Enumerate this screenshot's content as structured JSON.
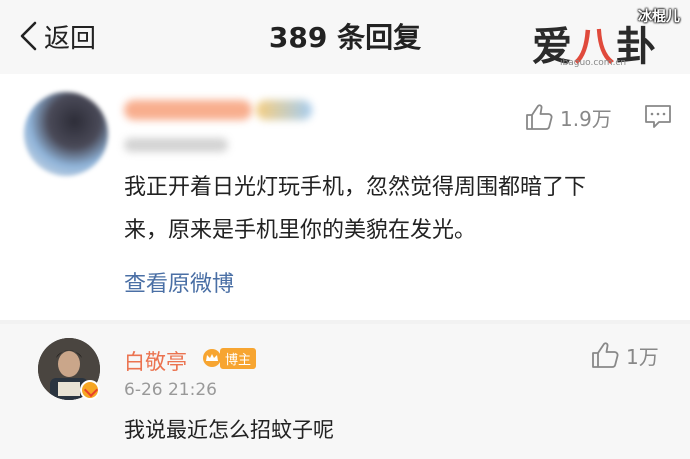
{
  "header": {
    "back_label": "返回",
    "title": "389 条回复",
    "logo_text_a": "爱",
    "logo_text_b": "八",
    "logo_text_c": "卦",
    "logo_url_text": "ibaguo.com.cn",
    "watermark": "冰棍儿"
  },
  "comment": {
    "like_count": "1.9万",
    "text": "我正开着日光灯玩手机，忽然觉得周围都暗了下来，原来是手机里你的美貌在发光。",
    "view_original": "查看原微博"
  },
  "reply": {
    "author": "白敬亭",
    "badge": "博主",
    "time": "6-26 21:26",
    "like_count": "1万",
    "text": "我说最近怎么招蚊子呢"
  },
  "colors": {
    "accent_name": "#eb7350",
    "link_blue": "#4a6fa5",
    "badge_orange": "#f7a531"
  },
  "icons": [
    "back-chevron-icon",
    "thumbs-up-icon",
    "reply-bubble-icon",
    "crown-icon",
    "verified-icon"
  ]
}
